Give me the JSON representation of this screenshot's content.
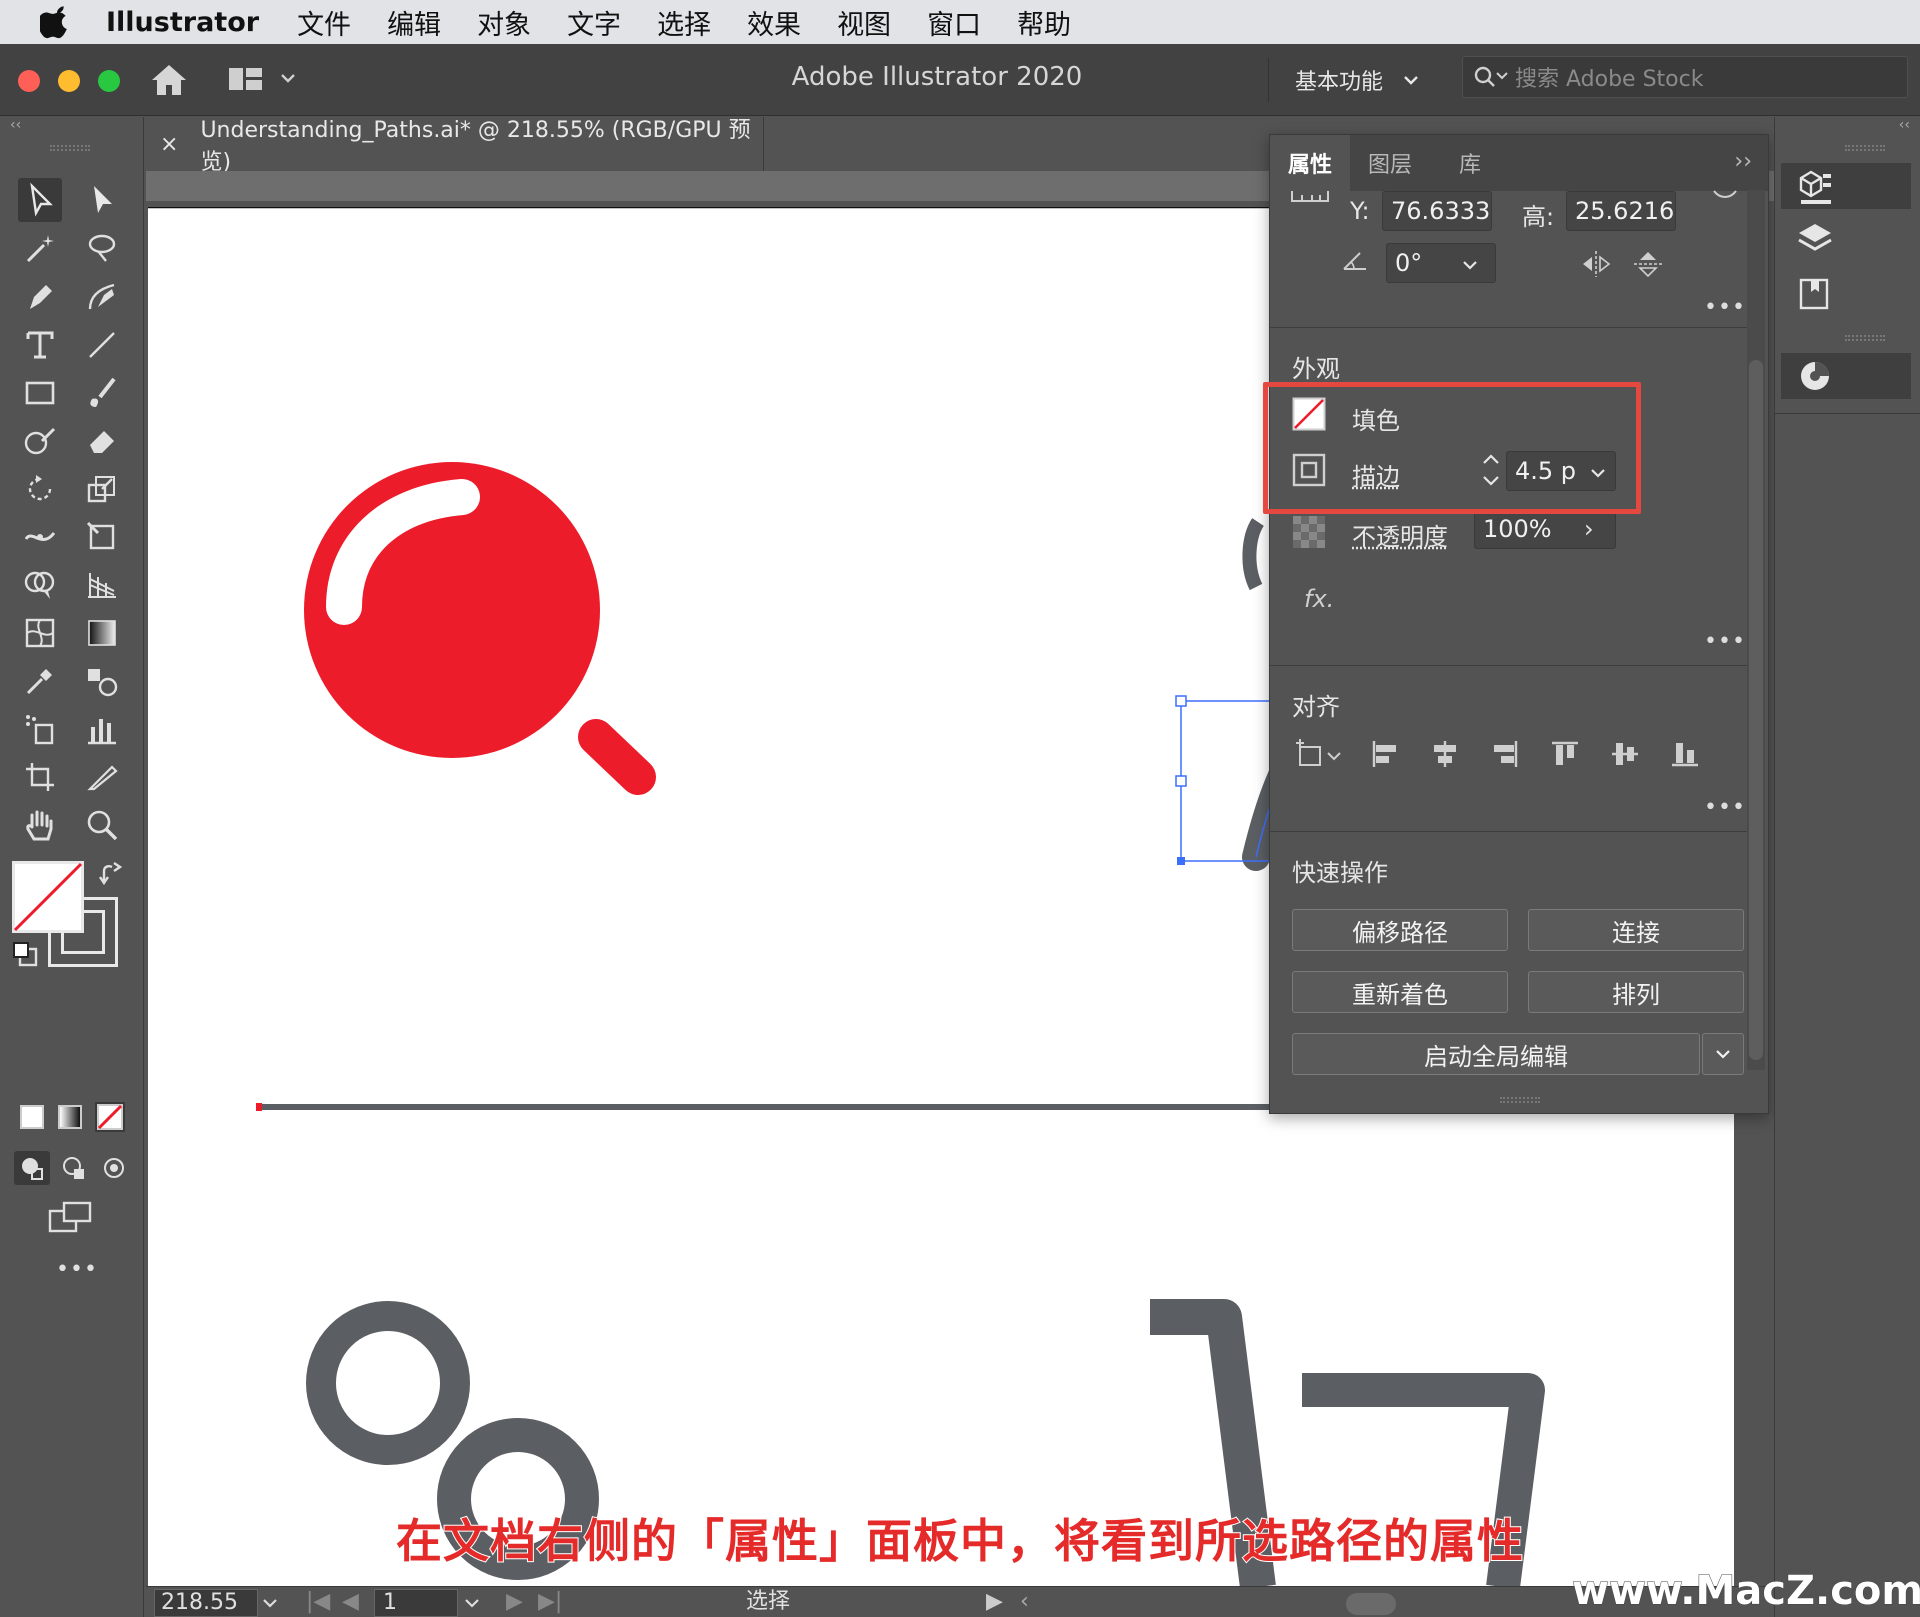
{
  "menubar": {
    "app_name": "Illustrator",
    "items": [
      "文件",
      "编辑",
      "对象",
      "文字",
      "选择",
      "效果",
      "视图",
      "窗口",
      "帮助"
    ]
  },
  "window": {
    "title": "Adobe Illustrator 2020",
    "workspace": "基本功能",
    "search_placeholder": "搜索 Adobe Stock"
  },
  "document": {
    "tab_close": "×",
    "tab_title": "Understanding_Paths.ai* @ 218.55% (RGB/GPU 预览)"
  },
  "properties_panel": {
    "tabs": [
      "属性",
      "图层",
      "库"
    ],
    "active_tab": "属性",
    "transform": {
      "y_label": "Y:",
      "y_value": "76.6333",
      "h_label": "高:",
      "h_value": "25.6216",
      "angle": "0°"
    },
    "appearance": {
      "title": "外观",
      "fill_label": "填色",
      "stroke_label": "描边",
      "stroke_value": "4.5 p",
      "opacity_label": "不透明度",
      "opacity_value": "100%",
      "fx": "fx."
    },
    "align": {
      "title": "对齐"
    },
    "quick_actions": {
      "title": "快速操作",
      "offset_path": "偏移路径",
      "join": "连接",
      "recolor": "重新着色",
      "arrange": "排列",
      "global_edit": "启动全局编辑"
    },
    "more": "•••"
  },
  "statusbar": {
    "zoom": "218.55",
    "page": "1",
    "tool": "选择"
  },
  "caption": "在文档右侧的「属性」面板中，将看到所选路径的属性",
  "watermark": "www.MacZ.com",
  "colors": {
    "accent_red": "#ed1c2b",
    "icon_gray": "#5b5f63",
    "highlight": "#e5483e",
    "selection_blue": "#3d6fff"
  }
}
